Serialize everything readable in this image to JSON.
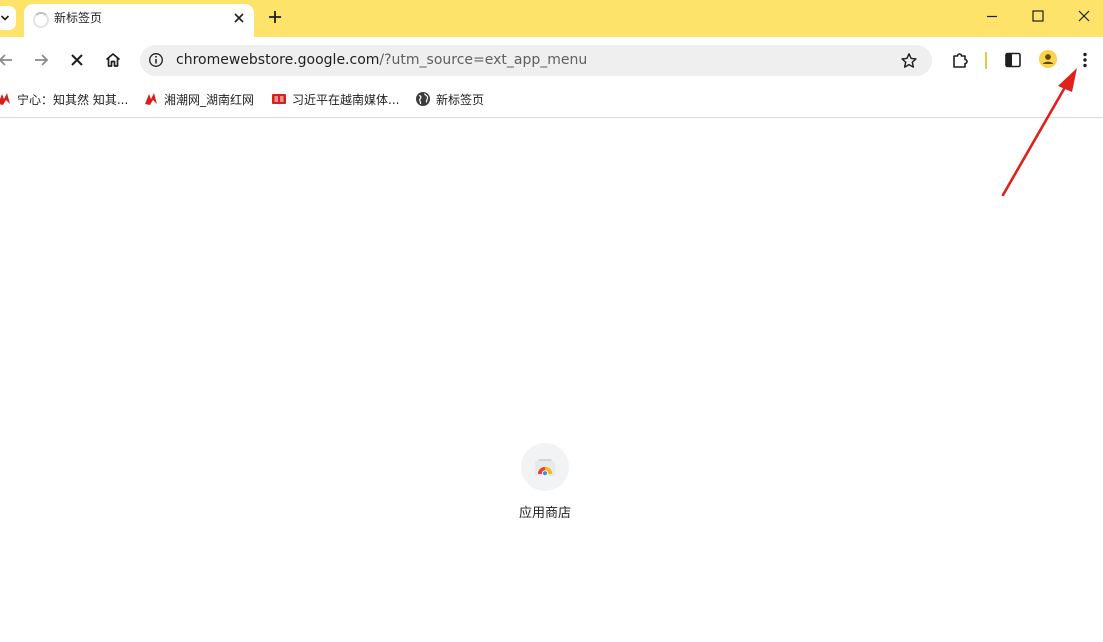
{
  "tabs": [
    {
      "title": "新标签页",
      "loading": true
    }
  ],
  "address_bar": {
    "host": "chromewebstore.google.com",
    "path": "/?utm_source=ext_app_menu"
  },
  "bookmarks": [
    {
      "label": "宁心：知其然 知其...",
      "icon": "red-brush-icon"
    },
    {
      "label": "湘潮网_湖南红网",
      "icon": "red-brush-icon"
    },
    {
      "label": "习近平在越南媒体...",
      "icon": "red-badge-icon"
    },
    {
      "label": "新标签页",
      "icon": "globe-icon"
    }
  ],
  "shortcuts": [
    {
      "label": "应用商店",
      "icon": "chrome-web-store-icon"
    }
  ],
  "colors": {
    "titlebar": "#fde36a",
    "annotation_arrow": "#e0201b"
  }
}
